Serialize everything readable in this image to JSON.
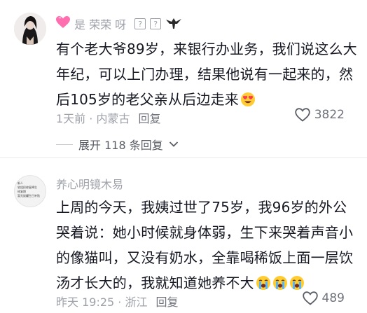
{
  "comments": [
    {
      "username": "是 荣荣 呀",
      "badge_boxes": [
        "?",
        "?"
      ],
      "text": "有个老大爷89岁，来银行办业务，我们说这么大年纪，可以上门办理，结果他说有一起来的，然后105岁的老父亲从后边走来",
      "time_location": "1天前 · 内蒙古",
      "reply_label": "回复",
      "likes": "3822",
      "expand_label": "展开 118 条回复"
    },
    {
      "username": "养心明镜木易",
      "avatar_text": [
        "新人",
        "软组织修复降生",
        "修复期",
        "暂无拔罐生日补贴"
      ],
      "text": "上周的今天，我姨过世了75岁，我96岁的外公哭着说：她小时候就身体弱，生下来哭着声音小的像猫叫，又没有奶水，全靠喝稀饭上面一层饮汤才长大的，我就知道她养不大",
      "time_location": "昨天 19:25 · 浙江",
      "reply_label": "回复",
      "likes": "489"
    }
  ],
  "icons": {
    "name_prefix": "heart-icon",
    "eagle": "eagle-icon",
    "like": "like-heart-icon",
    "expand_chevron": "chevron-down-icon",
    "heart_eyes": "heart-eyes-emoji-icon",
    "crying": "loudly-crying-emoji-icon"
  },
  "colors": {
    "primary_text": "#161823",
    "secondary_text": "#9ea1a9",
    "accent_pink": "#fe2c55"
  }
}
